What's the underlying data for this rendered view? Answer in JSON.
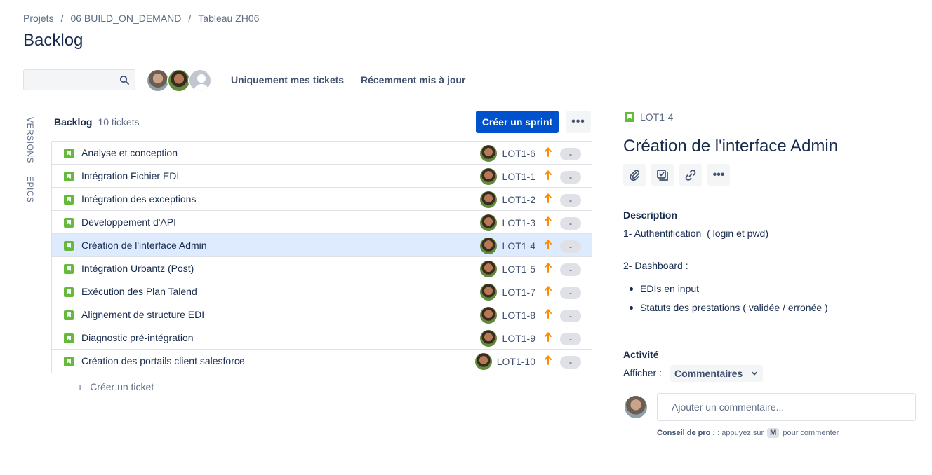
{
  "breadcrumb": [
    "Projets",
    "06 BUILD_ON_DEMAND",
    "Tableau ZH06"
  ],
  "page_title": "Backlog",
  "search": {
    "placeholder": "",
    "value": ""
  },
  "filters": {
    "mine": "Uniquement mes tickets",
    "recent": "Récemment mis à jour"
  },
  "side_tabs": {
    "versions": "VERSIONS",
    "epics": "EPICS"
  },
  "backlog": {
    "title": "Backlog",
    "count": "10 tickets",
    "create_sprint": "Créer un sprint",
    "more": "•••",
    "create_ticket": "Créer un ticket",
    "create_plus": "+",
    "issues": [
      {
        "summary": "Analyse et conception",
        "key": "LOT1-6",
        "estimate": "-"
      },
      {
        "summary": "Intégration Fichier EDI",
        "key": "LOT1-1",
        "estimate": "-"
      },
      {
        "summary": "Intégration des exceptions",
        "key": "LOT1-2",
        "estimate": "-"
      },
      {
        "summary": "Développement d'API",
        "key": "LOT1-3",
        "estimate": "-"
      },
      {
        "summary": "Création de l'interface Admin",
        "key": "LOT1-4",
        "estimate": "-"
      },
      {
        "summary": "Intégration Urbantz (Post)",
        "key": "LOT1-5",
        "estimate": "-"
      },
      {
        "summary": "Exécution des Plan Talend",
        "key": "LOT1-7",
        "estimate": "-"
      },
      {
        "summary": "Alignement de structure EDI",
        "key": "LOT1-8",
        "estimate": "-"
      },
      {
        "summary": "Diagnostic pré-intégration",
        "key": "LOT1-9",
        "estimate": "-"
      },
      {
        "summary": "Création des portails client salesforce",
        "key": "LOT1-10",
        "estimate": "-"
      }
    ]
  },
  "detail": {
    "key": "LOT1-4",
    "title": "Création de l'interface Admin",
    "more": "•••",
    "description_label": "Description",
    "desc_line1": "1- Authentification  ( login et pwd)",
    "desc_line2": "2- Dashboard :",
    "bullets": [
      "EDIs en input",
      "Statuts des prestations ( validée / erronée )"
    ],
    "activity_label": "Activité",
    "show_label": "Afficher :",
    "show_value": "Commentaires",
    "comment_placeholder": "Ajouter un commentaire...",
    "tip_bold": "Conseil de pro :",
    "tip_text": ": appuyez sur",
    "tip_key": "M",
    "tip_suffix": "pour commenter"
  },
  "colors": {
    "primary": "#0052cc",
    "story": "#63ba3c",
    "priority_high": "#ff8b00",
    "selected_row": "#deebff"
  }
}
